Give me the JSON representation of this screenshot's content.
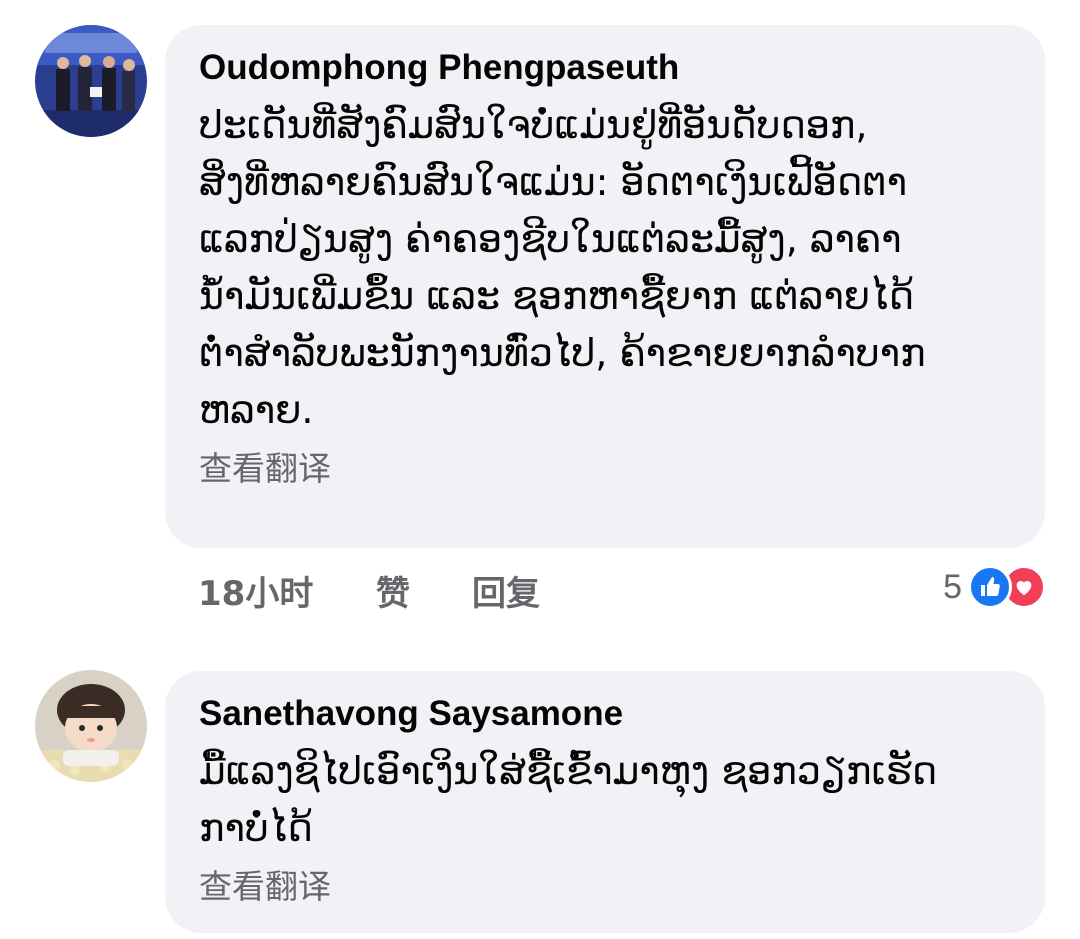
{
  "comments": [
    {
      "author": "Oudomphong Phengpaseuth",
      "text": "ປະເດັນທີ່ສັງຄົມສົນໃຈບໍ່ແມ່ນຢູ່ທີ່ອັນດັບດອກ,\nສິ່ງທີ່ຫລາຍຄົນສົນໃຈແມ່ນ: ອັດຕາເງິນເຟີ້ອັດຕາ\nແລກປ່ຽນສູງ ຄ່າຄອງຊີບໃນແຕ່ລະມື້ສູງ, ລາຄາ\nນ້ຳມັນເພີ່ມຂຶ້ນ ແລະ ຊອກຫາຊື້ຍາກ ແຕ່ລາຍໄດ້\nຕ່ຳສຳລັບພະນັກງານທົ່ວໄປ, ຄ້າຂາຍຍາກລຳບາກ\nຫລາຍ.",
      "translate_label": "查看翻译",
      "time": "18小时",
      "like_label": "赞",
      "reply_label": "回复",
      "reaction_count": "5",
      "reactions": [
        "like-icon",
        "love-icon"
      ]
    },
    {
      "author": "Sanethavong Saysamone",
      "text": "ມື້ແລງຊິໄປເອົາເງິນໃສ່ຊື້ເຂົ້າມາຫຸງ ຊອກວຽກເຮັດ\nກາບໍ່ໄດ້",
      "translate_label": "查看翻译"
    }
  ],
  "colors": {
    "bubble": "#f0f2f5",
    "meta_text": "#65676b",
    "like": "#1877f2",
    "love": "#f33e58"
  }
}
